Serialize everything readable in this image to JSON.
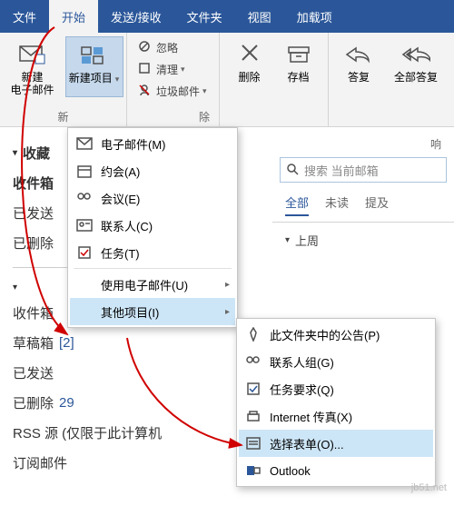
{
  "tabs": {
    "file": "文件",
    "home": "开始",
    "sendrecv": "发送/接收",
    "folder": "文件夹",
    "view": "视图",
    "addins": "加载项"
  },
  "ribbon": {
    "new_email": "新建\n电子邮件",
    "new_items": "新建项目",
    "group_new": "新",
    "ignore": "忽略",
    "cleanup": "清理",
    "junk": "垃圾邮件",
    "group_del_tail": "除",
    "delete": "删除",
    "archive": "存档",
    "reply": "答复",
    "reply_all": "全部答复",
    "group_resp_tail": "响"
  },
  "nav": {
    "fav": "收藏",
    "inbox": "收件箱",
    "sent": "已发送",
    "deleted": "已删除",
    "inbox2": "收件箱",
    "drafts_label": "草稿箱",
    "drafts_count": "[2]",
    "sent2": "已发送",
    "deleted2_label": "已删除",
    "deleted2_count": "29",
    "rss": "RSS 源 (仅限于此计算机",
    "sub": "订阅邮件"
  },
  "menu1": {
    "email": "电子邮件(M)",
    "appt": "约会(A)",
    "meeting": "会议(E)",
    "contact": "联系人(C)",
    "task": "任务(T)",
    "use_email": "使用电子邮件(U)",
    "other": "其他项目(I)"
  },
  "menu2": {
    "post": "此文件夹中的公告(P)",
    "group": "联系人组(G)",
    "taskreq": "任务要求(Q)",
    "fax": "Internet 传真(X)",
    "form": "选择表单(O)...",
    "outlook": "Outlook"
  },
  "right": {
    "resp_tail": "响",
    "search_ph": "搜索 当前邮箱",
    "filter_all": "全部",
    "filter_unread": "未读",
    "filter_mention": "提及",
    "group_lastweek": "上周"
  },
  "watermark": "jb51.net"
}
